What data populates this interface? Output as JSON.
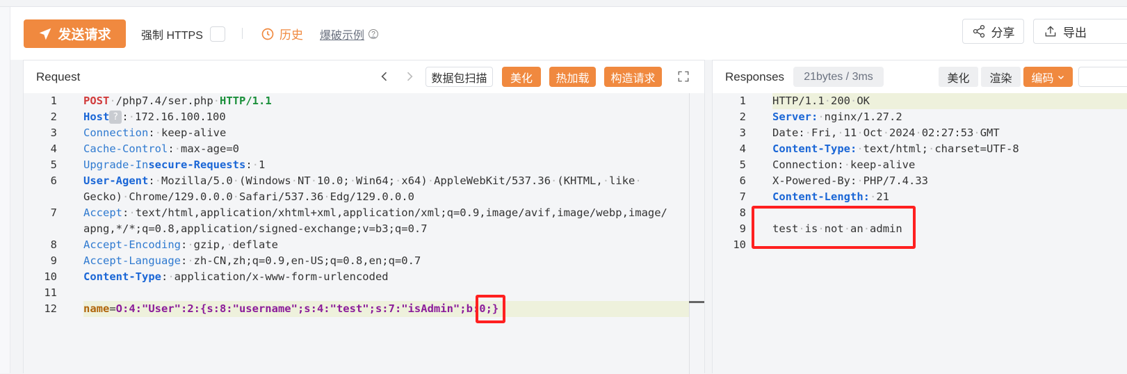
{
  "toolbar": {
    "send_label": "发送请求",
    "force_https_label": "强制 HTTPS",
    "history_label": "历史",
    "example_label": "爆破示例",
    "share_label": "分享",
    "export_label": "导出",
    "accent_color": "#f0893f"
  },
  "request": {
    "title": "Request",
    "scan_label": "数据包扫描",
    "beautify_label": "美化",
    "hotload_label": "热加载",
    "construct_label": "构造请求",
    "host_badge": "?",
    "lines": [
      {
        "n": "1",
        "parts": [
          [
            "k-red",
            "POST"
          ],
          [
            "dot",
            "·"
          ],
          [
            "",
            "/php7.4/ser.php"
          ],
          [
            "dot",
            "·"
          ],
          [
            "k-green",
            "HTTP/1.1"
          ]
        ]
      },
      {
        "n": "2",
        "parts": [
          [
            "k-blue",
            "Host"
          ],
          [
            "badge",
            "?"
          ],
          [
            "",
            ":"
          ],
          [
            "dot",
            "·"
          ],
          [
            "",
            "172.16.100.100"
          ]
        ]
      },
      {
        "n": "3",
        "parts": [
          [
            "k-blue-n",
            "Connection"
          ],
          [
            "",
            ":"
          ],
          [
            "dot",
            "·"
          ],
          [
            "",
            "keep-alive"
          ]
        ]
      },
      {
        "n": "4",
        "parts": [
          [
            "k-blue-n",
            "Cache-Control"
          ],
          [
            "",
            ":"
          ],
          [
            "dot",
            "·"
          ],
          [
            "",
            "max-age=0"
          ]
        ]
      },
      {
        "n": "5",
        "parts": [
          [
            "k-blue-n",
            "Upgrade-In"
          ],
          [
            "k-blue",
            "secure-Requests"
          ],
          [
            "",
            ":"
          ],
          [
            "dot",
            "·"
          ],
          [
            "",
            "1"
          ]
        ]
      },
      {
        "n": "6",
        "parts": [
          [
            "k-blue",
            "User-Agent"
          ],
          [
            "",
            ":"
          ],
          [
            "dot",
            "·"
          ],
          [
            "",
            "Mozilla/5.0"
          ],
          [
            "dot",
            "·"
          ],
          [
            "",
            "(Windows"
          ],
          [
            "dot",
            "·"
          ],
          [
            "",
            "NT"
          ],
          [
            "dot",
            "·"
          ],
          [
            "",
            "10.0;"
          ],
          [
            "dot",
            "·"
          ],
          [
            "",
            "Win64;"
          ],
          [
            "dot",
            "·"
          ],
          [
            "",
            "x64)"
          ],
          [
            "dot",
            "·"
          ],
          [
            "",
            "AppleWebKit/537.36"
          ],
          [
            "dot",
            "·"
          ],
          [
            "",
            "(KHTML,"
          ],
          [
            "dot",
            "·"
          ],
          [
            "",
            "like"
          ],
          [
            "dot",
            "·"
          ]
        ]
      },
      {
        "n": "",
        "parts": [
          [
            "",
            "Gecko)"
          ],
          [
            "dot",
            "·"
          ],
          [
            "",
            "Chrome/129.0.0.0"
          ],
          [
            "dot",
            "·"
          ],
          [
            "",
            "Safari/537.36"
          ],
          [
            "dot",
            "·"
          ],
          [
            "",
            "Edg/129.0.0.0"
          ]
        ]
      },
      {
        "n": "7",
        "parts": [
          [
            "k-blue-n",
            "Accept"
          ],
          [
            "",
            ":"
          ],
          [
            "dot",
            "·"
          ],
          [
            "",
            "text/html,application/xhtml+xml,application/xml;q=0.9,image/avif,image/webp,image/"
          ]
        ]
      },
      {
        "n": "",
        "parts": [
          [
            "",
            "apng,*/*;q=0.8,application/signed-exchange;v=b3;q=0.7"
          ]
        ]
      },
      {
        "n": "8",
        "parts": [
          [
            "k-blue-n",
            "Accept-Encoding"
          ],
          [
            "",
            ":"
          ],
          [
            "dot",
            "·"
          ],
          [
            "",
            "gzip,"
          ],
          [
            "dot",
            "·"
          ],
          [
            "",
            "deflate"
          ]
        ]
      },
      {
        "n": "9",
        "parts": [
          [
            "k-blue-n",
            "Accept-Language"
          ],
          [
            "",
            ":"
          ],
          [
            "dot",
            "·"
          ],
          [
            "",
            "zh-CN,zh;q=0.9,en-US;q=0.8,en;q=0.7"
          ]
        ]
      },
      {
        "n": "10",
        "parts": [
          [
            "k-blue",
            "Content-Type"
          ],
          [
            "",
            ":"
          ],
          [
            "dot",
            "·"
          ],
          [
            "",
            "application/x-www-form-urlencoded"
          ]
        ]
      },
      {
        "n": "11",
        "parts": []
      },
      {
        "n": "12",
        "parts": [
          [
            "k-orange",
            "name"
          ],
          [
            "",
            "="
          ],
          [
            "k-purple",
            "O:4:\"User\":2:{s:8:\"username\";s:4:\"test\";s:7:\"isAdmin\";b:0;}"
          ]
        ]
      }
    ]
  },
  "response": {
    "title": "Responses",
    "meta": "21bytes / 3ms",
    "beautify_label": "美化",
    "render_label": "渲染",
    "encode_label": "编码",
    "lines": [
      {
        "n": "1",
        "parts": [
          [
            "",
            "HTTP/1.1"
          ],
          [
            "dot",
            "·"
          ],
          [
            "",
            "200"
          ],
          [
            "dot",
            "·"
          ],
          [
            "",
            "OK"
          ]
        ]
      },
      {
        "n": "2",
        "parts": [
          [
            "k-blue",
            "Server:"
          ],
          [
            "dot",
            "·"
          ],
          [
            "",
            "nginx/1.27.2"
          ]
        ]
      },
      {
        "n": "3",
        "parts": [
          [
            "",
            "Date:"
          ],
          [
            "dot",
            "·"
          ],
          [
            "",
            "Fri,"
          ],
          [
            "dot",
            "·"
          ],
          [
            "",
            "11"
          ],
          [
            "dot",
            "·"
          ],
          [
            "",
            "Oct"
          ],
          [
            "dot",
            "·"
          ],
          [
            "",
            "2024"
          ],
          [
            "dot",
            "·"
          ],
          [
            "",
            "02:27:53"
          ],
          [
            "dot",
            "·"
          ],
          [
            "",
            "GMT"
          ]
        ]
      },
      {
        "n": "4",
        "parts": [
          [
            "k-blue",
            "Content-Type:"
          ],
          [
            "dot",
            "·"
          ],
          [
            "",
            "text/html;"
          ],
          [
            "dot",
            "·"
          ],
          [
            "",
            "charset=UTF-8"
          ]
        ]
      },
      {
        "n": "5",
        "parts": [
          [
            "",
            "Connection:"
          ],
          [
            "dot",
            "·"
          ],
          [
            "",
            "keep-alive"
          ]
        ]
      },
      {
        "n": "6",
        "parts": [
          [
            "",
            "X-Powered-By:"
          ],
          [
            "dot",
            "·"
          ],
          [
            "",
            "PHP/7.4.33"
          ]
        ]
      },
      {
        "n": "7",
        "parts": [
          [
            "k-blue",
            "Content-Length:"
          ],
          [
            "dot",
            "·"
          ],
          [
            "",
            "21"
          ]
        ]
      },
      {
        "n": "8",
        "parts": []
      },
      {
        "n": "9",
        "parts": [
          [
            "",
            "test"
          ],
          [
            "dot",
            "·"
          ],
          [
            "",
            "is"
          ],
          [
            "dot",
            "·"
          ],
          [
            "",
            "not"
          ],
          [
            "dot",
            "·"
          ],
          [
            "",
            "an"
          ],
          [
            "dot",
            "·"
          ],
          [
            "",
            "admin"
          ]
        ]
      },
      {
        "n": "10",
        "parts": []
      }
    ]
  }
}
